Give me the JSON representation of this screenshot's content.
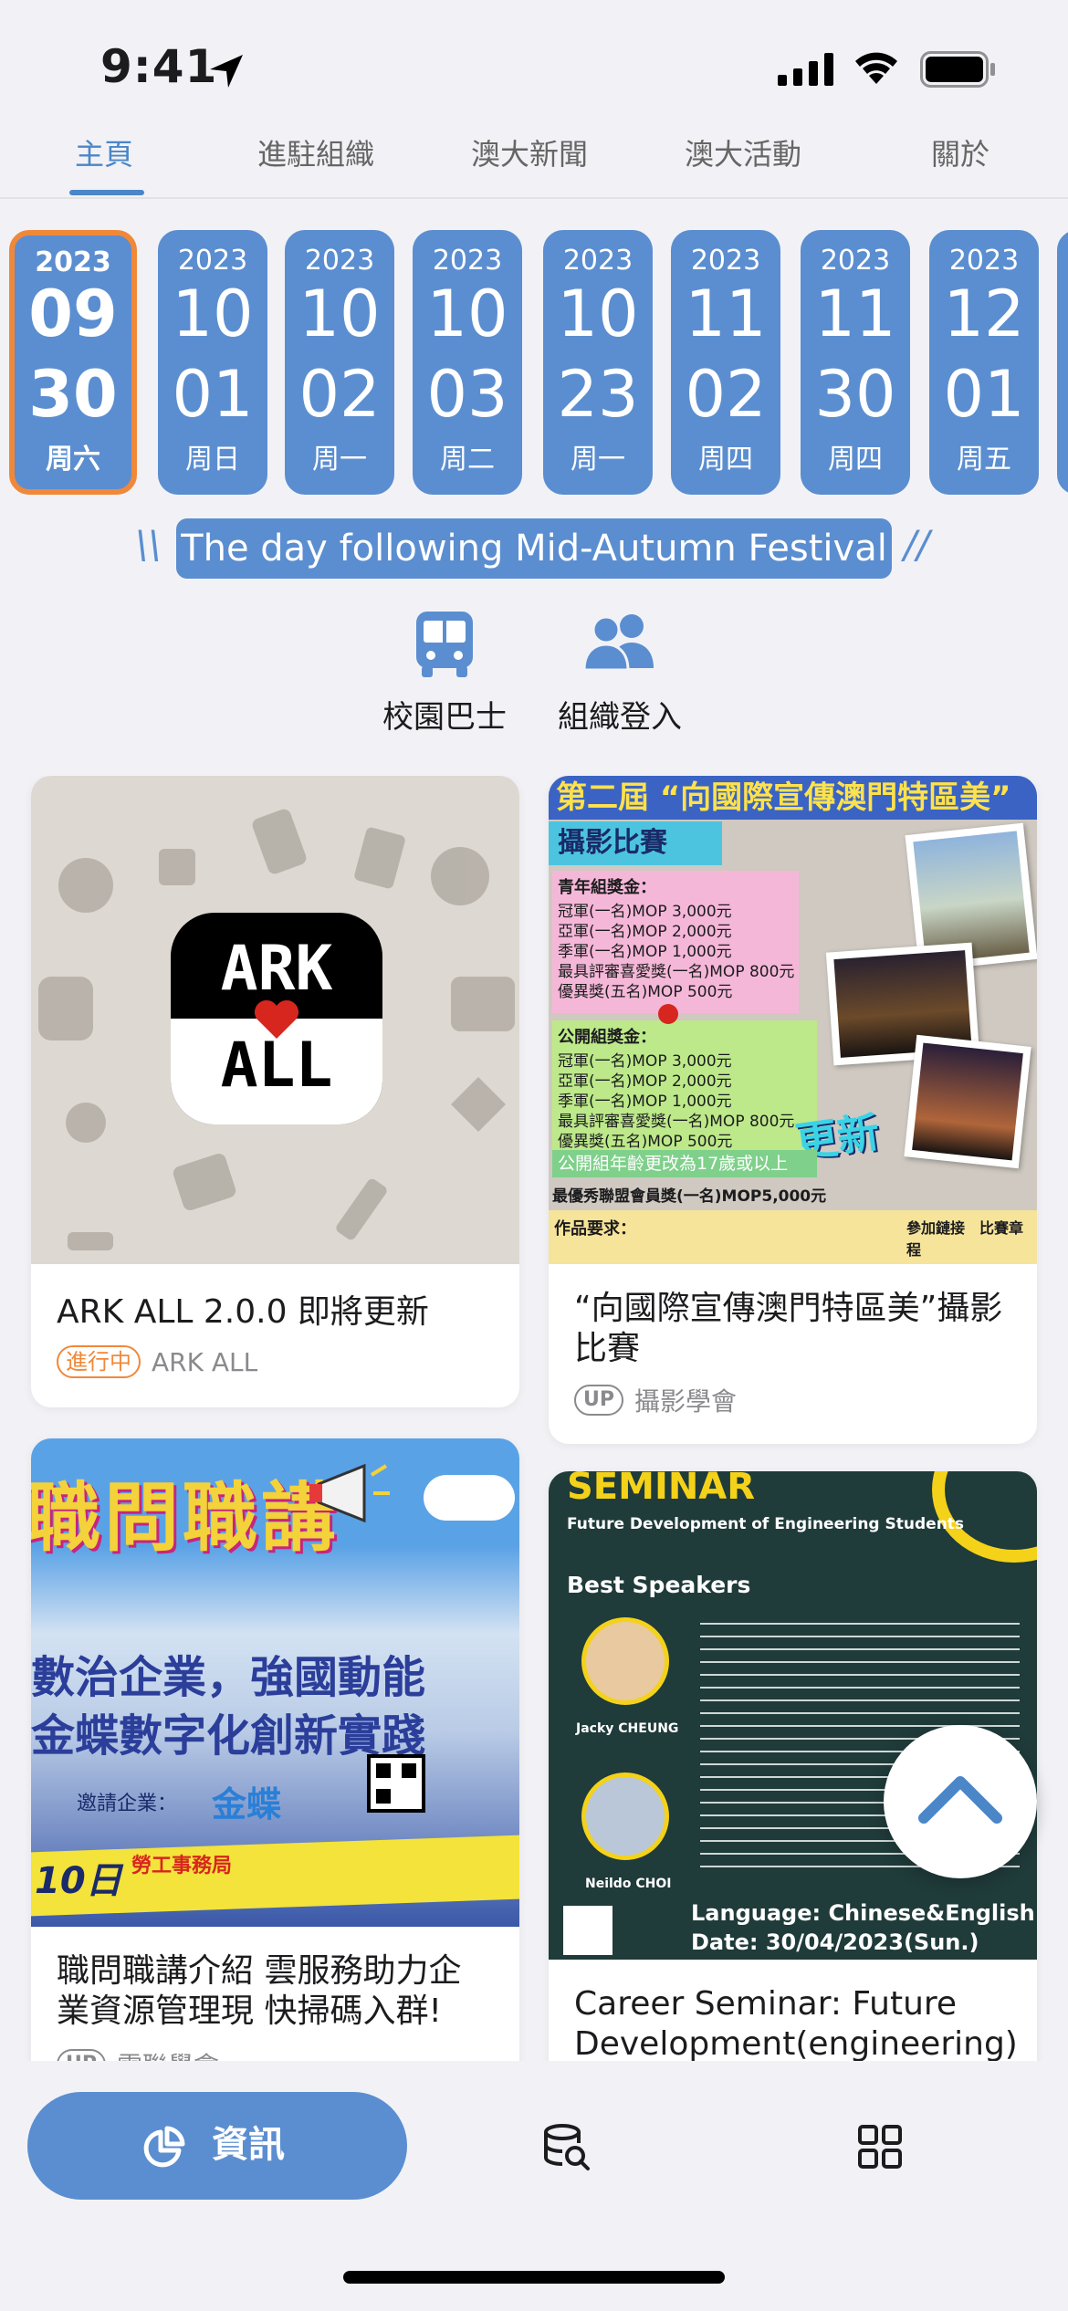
{
  "status_bar": {
    "time": "9:41"
  },
  "tabs": [
    {
      "label": "主頁",
      "active": true
    },
    {
      "label": "進駐組織",
      "active": false
    },
    {
      "label": "澳大新聞",
      "active": false
    },
    {
      "label": "澳大活動",
      "active": false
    },
    {
      "label": "關於",
      "active": false
    }
  ],
  "dates": [
    {
      "year": "2023",
      "month": "09",
      "day": "30",
      "weekday": "周六",
      "selected": true
    },
    {
      "year": "2023",
      "month": "10",
      "day": "01",
      "weekday": "周日"
    },
    {
      "year": "2023",
      "month": "10",
      "day": "02",
      "weekday": "周一"
    },
    {
      "year": "2023",
      "month": "10",
      "day": "03",
      "weekday": "周二"
    },
    {
      "year": "2023",
      "month": "10",
      "day": "23",
      "weekday": "周一"
    },
    {
      "year": "2023",
      "month": "11",
      "day": "02",
      "weekday": "周四"
    },
    {
      "year": "2023",
      "month": "11",
      "day": "30",
      "weekday": "周四"
    },
    {
      "year": "2023",
      "month": "12",
      "day": "01",
      "weekday": "周五"
    }
  ],
  "holiday": {
    "left_mark": "\\\\",
    "text": "The day following Mid-Autumn Festival",
    "right_mark": "//"
  },
  "quick_actions": [
    {
      "label": "校園巴士",
      "icon": "bus-icon"
    },
    {
      "label": "組織登入",
      "icon": "people-icon"
    }
  ],
  "cards": {
    "ark": {
      "title": "ARK ALL 2.0.0 即將更新",
      "status": "進行中",
      "org": "ARK ALL",
      "logo_top": "ARK",
      "logo_bottom": "ALL"
    },
    "photo": {
      "title": "“向國際宣傳澳門特區美”攝影比賽",
      "badge": "UP",
      "org": "攝影學會",
      "poster_header": "第二屆 “向國際宣傳澳門特區美”",
      "poster_sub": "攝影比賽",
      "poster_youth_title": "青年組獎金：",
      "poster_youth_lines": [
        "冠軍(一名)MOP 3,000元",
        "亞軍(一名)MOP 2,000元",
        "季軍(一名)MOP 1,000元",
        "最具評審喜愛獎(一名)MOP 800元",
        "優異獎(五名)MOP 500元"
      ],
      "poster_public_title": "公開組獎金：",
      "poster_public_lines": [
        "冠軍(一名)MOP 3,000元",
        "亞軍(一名)MOP 2,000元",
        "季軍(一名)MOP 1,000元",
        "最具評審喜愛獎(一名)MOP 800元",
        "優異獎(五名)MOP 500元"
      ],
      "poster_update": "更新",
      "poster_age_note": "公開組年齡更改為17歲或以上",
      "poster_best_member": "最優秀聯盟會員獎(一名)MOP5,000元",
      "poster_req": "作品要求：",
      "poster_link": "參加鏈接　比賽章程"
    },
    "career": {
      "title": "職問職講介紹 雲服務助力企業資源管理現 快掃碼入群!",
      "badge": "UP",
      "org": "雲聯學會",
      "poster_top": "職問職講",
      "poster_line1": "數治企業，強國動能",
      "poster_line2": "金蝶數字化創新實踐",
      "poster_invite": "邀請企業：",
      "poster_brand": "金蝶",
      "poster_date": "10日",
      "poster_venue": "勞工事務局"
    },
    "seminar": {
      "title": "Career Seminar: Future Development(engineering)",
      "poster_heading": "SEMINAR",
      "poster_sub": "Future Development of Engineering Students",
      "poster_speakers_label": "Best Speakers",
      "speaker1": "Jacky CHEUNG",
      "speaker2": "Neildo CHOI",
      "poster_lang": "Language: Chinese&English",
      "poster_date": "Date: 30/04/2023(Sun.)"
    }
  },
  "bottom_nav": {
    "active_label": "資訊"
  },
  "colors": {
    "accent": "#5b8ed0",
    "tab_active": "#4a86c8",
    "selected_border": "#f0883a"
  }
}
